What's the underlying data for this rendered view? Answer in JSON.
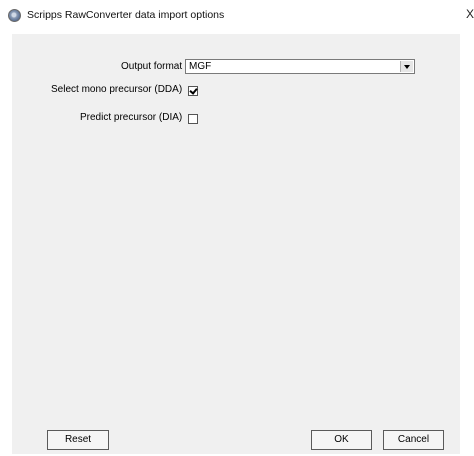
{
  "window": {
    "title": "Scripps RawConverter data import options",
    "close_glyph": "X"
  },
  "form": {
    "output_format_label": "Output format",
    "output_format_value": "MGF",
    "mono_precursor_label": "Select mono precursor (DDA)",
    "mono_precursor_checked": true,
    "predict_precursor_label": "Predict precursor (DIA)",
    "predict_precursor_checked": false
  },
  "buttons": {
    "reset": "Reset",
    "ok": "OK",
    "cancel": "Cancel"
  }
}
